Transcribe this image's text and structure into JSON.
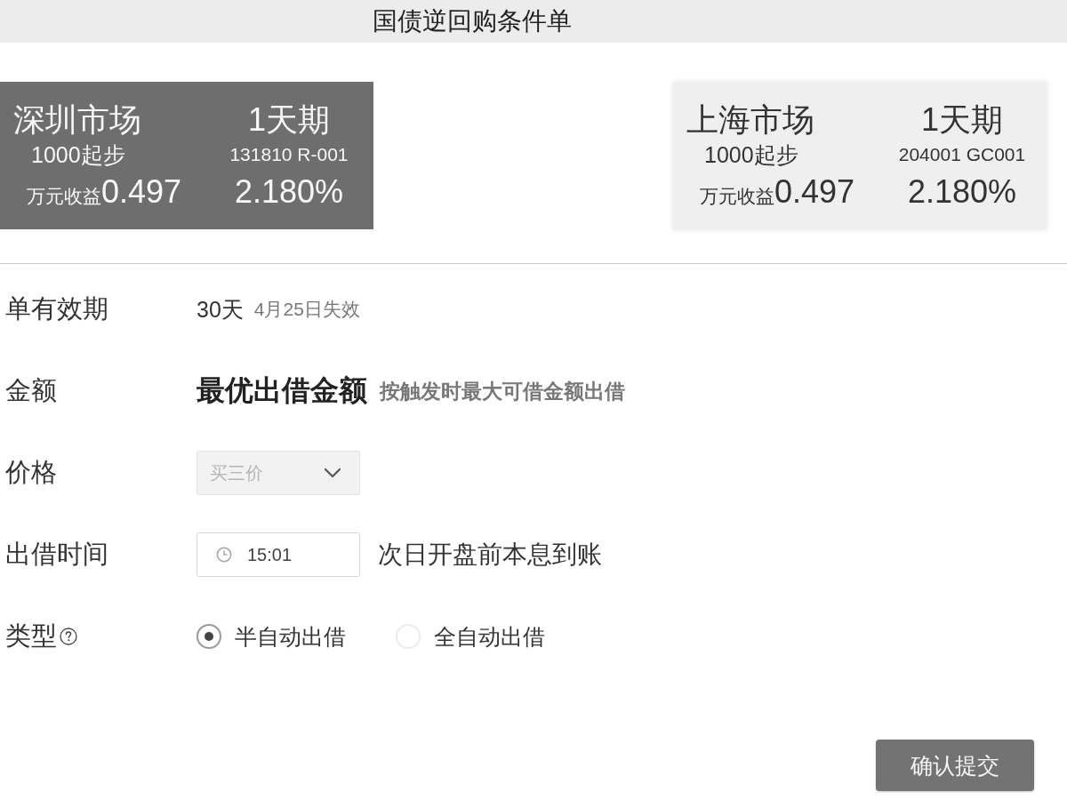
{
  "window": {
    "title": "国债逆回购条件单"
  },
  "markets": [
    {
      "name": "深圳市场",
      "term": "1天期",
      "minimum": "1000起步",
      "code": "131810 R-001",
      "yield_label": "万元收益",
      "yield_value": "0.497",
      "rate": "2.180%",
      "selected": true
    },
    {
      "name": "上海市场",
      "term": "1天期",
      "minimum": "1000起步",
      "code": "204001 GC001",
      "yield_label": "万元收益",
      "yield_value": "0.497",
      "rate": "2.180%",
      "selected": false
    }
  ],
  "form": {
    "rows": [
      {
        "kind": "text",
        "label": "单有效期",
        "value": "30天",
        "note": "4月25日失效"
      },
      {
        "kind": "emphasis",
        "label": "金额",
        "value": "最优出借金额",
        "note": "按触发时最大可借金额出借"
      },
      {
        "kind": "select",
        "label": "价格",
        "value": "买三价",
        "disabled": true
      },
      {
        "kind": "time",
        "label": "出借时间",
        "value": "15:01",
        "note": "次日开盘前本息到账"
      },
      {
        "kind": "radio",
        "label": "类型",
        "help_icon": true,
        "options": [
          {
            "label": "半自动出借",
            "selected": true
          },
          {
            "label": "全自动出借",
            "selected": false
          }
        ]
      }
    ]
  },
  "submit_button": {
    "label": "确认提交"
  }
}
